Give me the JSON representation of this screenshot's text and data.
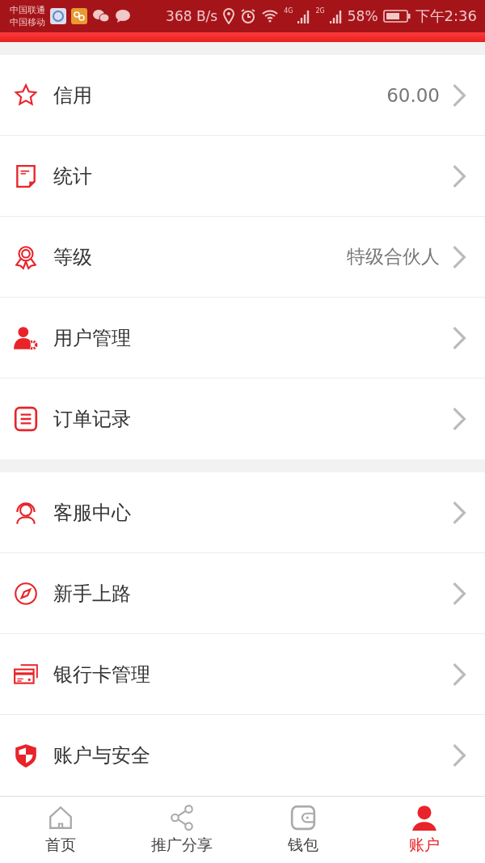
{
  "status_bar": {
    "carriers": [
      "中国联通",
      "中国移动"
    ],
    "speed": "368 B/s",
    "network_labels": [
      "4G",
      "2G"
    ],
    "battery": "58%",
    "time": "下午2:36"
  },
  "groups": [
    {
      "items": [
        {
          "label": "信用",
          "value": "60.00"
        },
        {
          "label": "统计"
        },
        {
          "label": "等级",
          "value": "特级合伙人"
        },
        {
          "label": "用户管理"
        },
        {
          "label": "订单记录"
        }
      ]
    },
    {
      "items": [
        {
          "label": "客服中心"
        },
        {
          "label": "新手上路"
        },
        {
          "label": "银行卡管理"
        },
        {
          "label": "账户与安全"
        }
      ]
    }
  ],
  "tab_bar": [
    {
      "label": "首页",
      "selected": false
    },
    {
      "label": "推广分享",
      "selected": false
    },
    {
      "label": "钱包",
      "selected": false
    },
    {
      "label": "账户",
      "selected": true
    }
  ]
}
